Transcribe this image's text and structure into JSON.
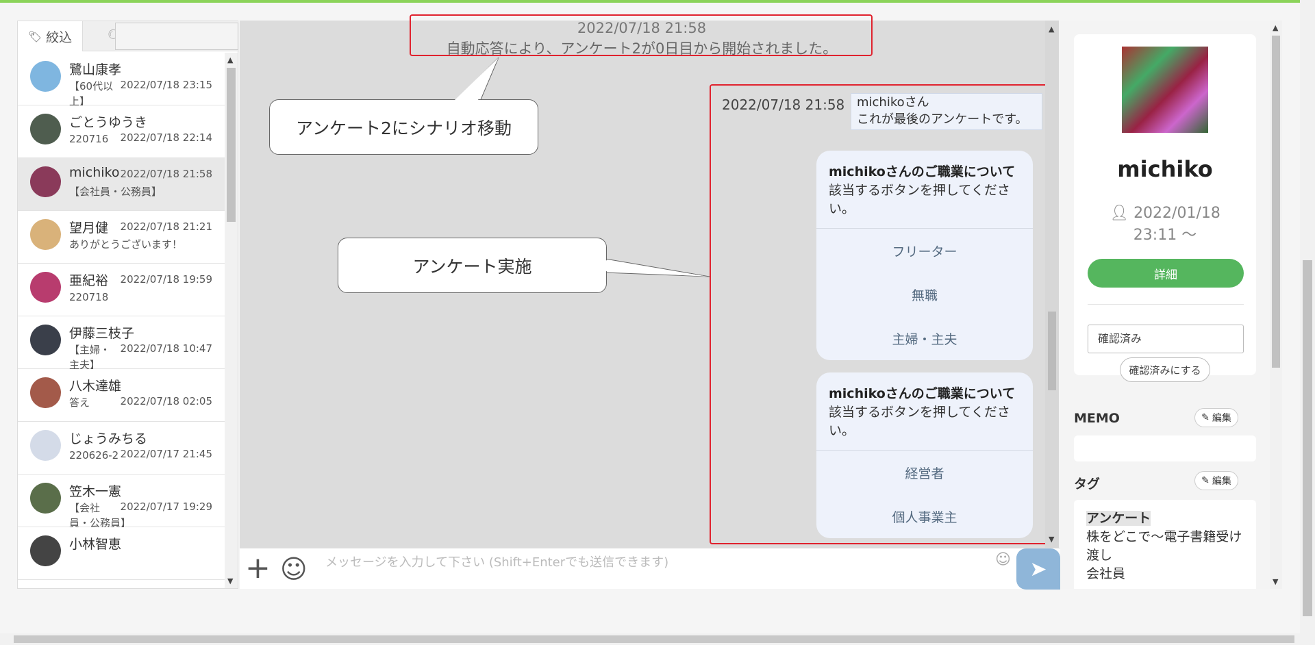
{
  "filter": {
    "label": "絞込"
  },
  "contacts": [
    {
      "name": "鷺山康孝",
      "snippet_line1": "【60代以",
      "snippet_line2": "上】",
      "time": "2022/07/18 23:15",
      "avatar_color": "#7fb6e0",
      "selected": false
    },
    {
      "name": "ごとうゆうき",
      "snippet_line1": "220716",
      "snippet_line2": "",
      "time": "2022/07/18 22:14",
      "avatar_color": "#4f5d4f",
      "selected": false
    },
    {
      "name": "michiko",
      "snippet_line1": "【会社員・公務員】",
      "snippet_line2": "",
      "time": "2022/07/18 21:58",
      "avatar_color": "#8a3a5a",
      "selected": true
    },
    {
      "name": "望月健",
      "snippet_line1": "ありがとうございます！",
      "snippet_line2": "",
      "time": "2022/07/18 21:21",
      "avatar_color": "#d9b27a",
      "selected": false
    },
    {
      "name": "亜紀裕",
      "snippet_line1": "220718",
      "snippet_line2": "",
      "time": "2022/07/18 19:59",
      "avatar_color": "#b83c6e",
      "selected": false
    },
    {
      "name": "伊藤三枝子",
      "snippet_line1": "【主婦・",
      "snippet_line2": "主夫】",
      "time": "2022/07/18 10:47",
      "avatar_color": "#3a3f4a",
      "selected": false
    },
    {
      "name": "八木達雄",
      "snippet_line1": "答え",
      "snippet_line2": "",
      "time": "2022/07/18 02:05",
      "avatar_color": "#a35a4a",
      "selected": false
    },
    {
      "name": "じょうみちる",
      "snippet_line1": "220626-2",
      "snippet_line2": "",
      "time": "2022/07/17 21:45",
      "avatar_color": "#d4dbe8",
      "selected": false
    },
    {
      "name": "笠木一憲",
      "snippet_line1": "【会社",
      "snippet_line2": "員・公務員】",
      "time": "2022/07/17 19:29",
      "avatar_color": "#5a6e4a",
      "selected": false
    },
    {
      "name": "小林智恵",
      "snippet_line1": "",
      "snippet_line2": "",
      "time": "",
      "avatar_color": "#444444",
      "selected": false
    }
  ],
  "chat": {
    "system_time": "2022/07/18 21:58",
    "system_text": "自動応答により、アンケート2が0日目から開始されました。",
    "callout_1": "アンケート2にシナリオ移動",
    "callout_2": "アンケート実施",
    "msg_time": "2022/07/18 21:58",
    "msg_line1": "michikoさん",
    "msg_line2": "これが最後のアンケートです。",
    "card1": {
      "title": "michikoさんのご職業について",
      "body": "該当するボタンを押してください。",
      "options": [
        "フリーター",
        "無職",
        "主婦・主夫"
      ]
    },
    "card2": {
      "title": "michikoさんのご職業について",
      "body": "該当するボタンを押してください。",
      "options": [
        "経営者",
        "個人事業主"
      ]
    },
    "input_placeholder": "メッセージを入力して下さい (Shift+Enterでも送信できます)"
  },
  "profile": {
    "name": "michiko",
    "date_line1": "2022/01/18",
    "date_line2": "23:11 ～",
    "detail_label": "詳細",
    "status_value": "確認済み",
    "confirm_label": "確認済みにする",
    "memo_title": "MEMO",
    "edit_label": "編集",
    "tag_title": "タグ",
    "tags": [
      "アンケート",
      "株をどこで～電子書籍受け渡し",
      "会社員"
    ]
  },
  "colors": {
    "accent_green": "#55b65e",
    "highlight_red": "#e0222e",
    "send_blue": "#8fb6d9"
  }
}
